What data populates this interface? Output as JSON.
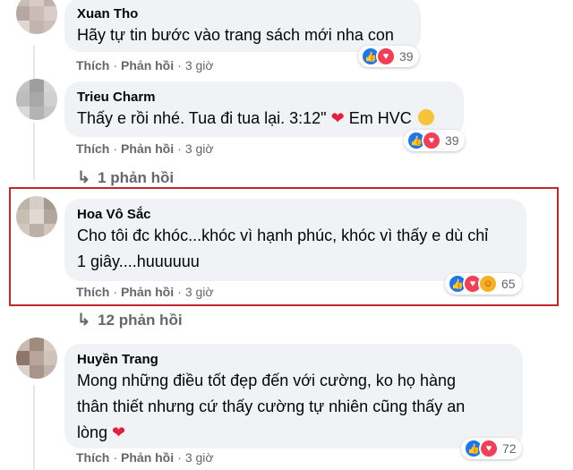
{
  "actions": {
    "like": "Thích",
    "reply": "Phản hồi",
    "separator": "·"
  },
  "comments": [
    {
      "author": "Xuan Tho",
      "text": "Hãy tự tin bước vào trang sách mới nha con",
      "time": "3 giờ",
      "reaction_count": "39",
      "reactions": [
        "like-icon",
        "love-icon"
      ]
    },
    {
      "author": "Trieu Charm",
      "text_before_heart": "Thấy e rồi nhé. Tua đi tua lại. 3:12\"",
      "text_after_heart": "Em HVC",
      "time": "3 giờ",
      "reaction_count": "39",
      "reactions": [
        "like-icon",
        "love-icon"
      ]
    },
    {
      "author": "Hoa Vô Sắc",
      "text_line1": "Cho tôi đc khóc...khóc vì hạnh phúc, khóc vì thấy e dù chỉ",
      "text_line2": "1 giây....huuuuuu",
      "time": "3 giờ",
      "reaction_count": "65",
      "reactions": [
        "like-icon",
        "love-icon",
        "care-icon"
      ]
    },
    {
      "author": "Huyền Trang",
      "text_line1": "Mong những điều tốt đẹp đến với cường, ko họ hàng",
      "text_line2": "thân thiết nhưng cứ thấy cường tự nhiên cũng thấy an",
      "text_line3": "lòng",
      "time": "3 giờ",
      "reaction_count": "72",
      "reactions": [
        "like-icon",
        "love-icon"
      ]
    }
  ],
  "reply_links": [
    {
      "label": "1 phản hồi"
    },
    {
      "label": "12 phản hồi"
    }
  ],
  "icons": {
    "heart": "❤",
    "arrow": "↳"
  },
  "colors": {
    "highlight": "#c0282d",
    "bubble": "#f0f2f5",
    "meta": "#65676b",
    "like": "#1877f2",
    "love": "#f33e58"
  }
}
